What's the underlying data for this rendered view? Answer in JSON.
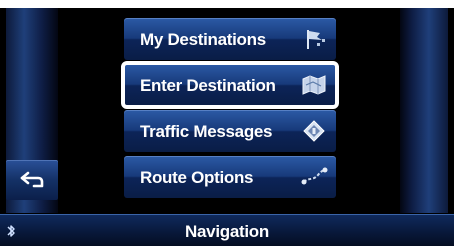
{
  "menu": {
    "items": [
      {
        "label": "My Destinations",
        "icon": "flag-icon",
        "selected": false
      },
      {
        "label": "Enter Destination",
        "icon": "map-icon",
        "selected": true
      },
      {
        "label": "Traffic Messages",
        "icon": "road-sign-icon",
        "selected": false
      },
      {
        "label": "Route Options",
        "icon": "route-options-icon",
        "selected": false
      }
    ]
  },
  "back_button": {
    "icon": "back-arrow-icon"
  },
  "status_bar": {
    "title": "Navigation",
    "icon": "bluetooth-icon"
  },
  "colors": {
    "button_gradient_top": "#2c5aa6",
    "button_gradient_bottom": "#0a1d46",
    "selection_outline": "#ffffff",
    "background": "#000000",
    "text": "#ffffff"
  }
}
